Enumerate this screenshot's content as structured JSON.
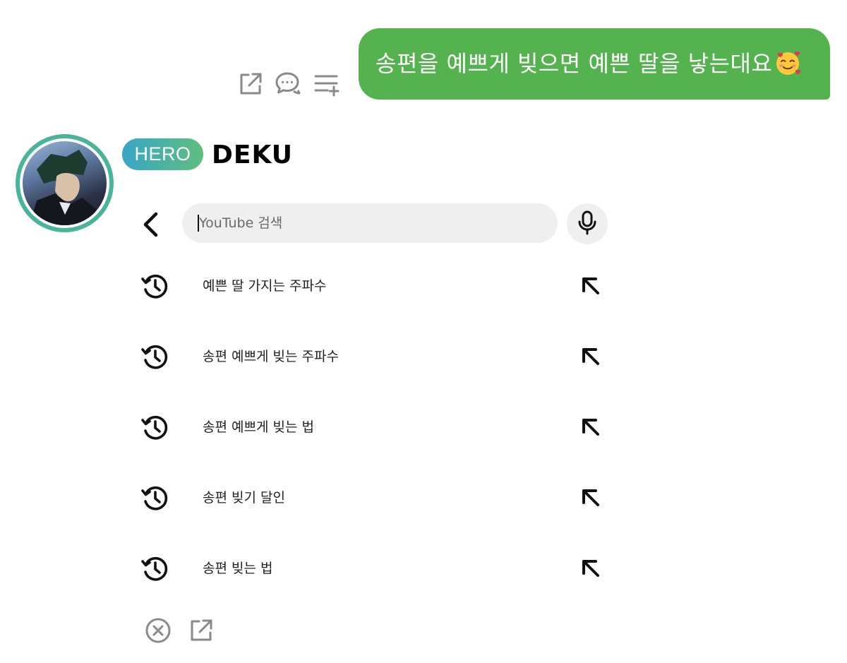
{
  "message": {
    "text": "송편을 예쁘게 빚으면 예쁜 딸을 낳는대요",
    "emoji_icon": "smiling-face-with-hearts-icon",
    "bubble_color": "#54b24f",
    "actions": [
      "share-icon",
      "comment-icon",
      "add-to-playlist-icon"
    ]
  },
  "sender": {
    "badge": "HERO",
    "name": "DEKU",
    "avatar_ring_color": "#48b59b",
    "badge_gradient": [
      "#38a6c5",
      "#5fbe7f"
    ]
  },
  "youtube": {
    "search": {
      "placeholder": "YouTube 검색",
      "value": ""
    },
    "suggestions": [
      "예쁜 딸 가지는 주파수",
      "송편 예쁘게 빚는 주파수",
      "송편 예쁘게 빚는 법",
      "송편 빚기 달인",
      "송편 빚는 법"
    ],
    "bottom_actions": [
      "close-circle-icon",
      "share-icon"
    ]
  }
}
